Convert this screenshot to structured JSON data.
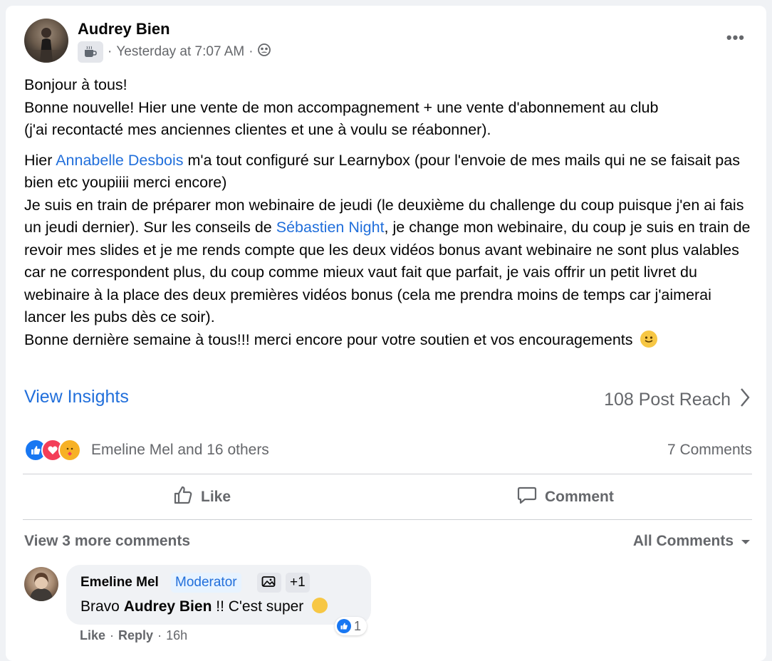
{
  "post": {
    "author": "Audrey Bien",
    "timestamp": "Yesterday at 7:07 AM",
    "separator": "·",
    "more_icon": "more-options-icon",
    "paragraphs": [
      {
        "lines": [
          "Bonjour à tous!",
          "Bonne nouvelle! Hier une vente de mon accompagnement + une vente d'abonnement au club",
          "(j'ai recontacté mes anciennes clientes et une à voulu se réabonner)."
        ]
      }
    ],
    "p2_pre": "Hier ",
    "mention_1": "Annabelle Desbois",
    "p2_mid": " m'a tout configuré sur Learnybox (pour l'envoie de mes mails qui ne se faisait pas bien etc youpiiii merci encore)",
    "p2_line2_pre": "Je suis en train de préparer mon webinaire de jeudi (le deuxième du challenge du coup puisque j'en ai fais un jeudi dernier). Sur les conseils de ",
    "mention_2": "Sébastien Night",
    "p2_line2_post": ", je change mon webinaire, du coup je suis en train de revoir mes slides et je me rends compte que les deux vidéos bonus avant webinaire ne sont plus valables car ne correspondent plus, du coup comme mieux vaut fait que parfait, je vais offrir un petit livret du webinaire à la place des deux premières vidéos bonus (cela me prendra moins de temps car j'aimerai lancer les pubs dès ce soir).",
    "p2_line3": "Bonne dernière semaine à tous!!! merci encore pour votre soutien et vos encouragements"
  },
  "insights": {
    "view_label": "View Insights",
    "reach_label": "108 Post Reach"
  },
  "reactions": {
    "summary": "Emeline Mel and 16 others",
    "comments_count": "7 Comments",
    "colors": {
      "like": "#1877f2",
      "love": "#f33e58",
      "care": "#f7b125"
    }
  },
  "actions": {
    "like_label": "Like",
    "comment_label": "Comment"
  },
  "comments_section": {
    "view_more": "View 3 more comments",
    "filter_label": "All Comments"
  },
  "comment": {
    "author": "Emeline Mel",
    "badge_moderator": "Moderator",
    "badge_plus": "+1",
    "text_pre": "Bravo ",
    "text_mention": "Audrey Bien",
    "text_post": " !! C'est super",
    "reaction_count": "1",
    "action_like": "Like",
    "action_reply": "Reply",
    "time": "16h",
    "dot": "·"
  }
}
